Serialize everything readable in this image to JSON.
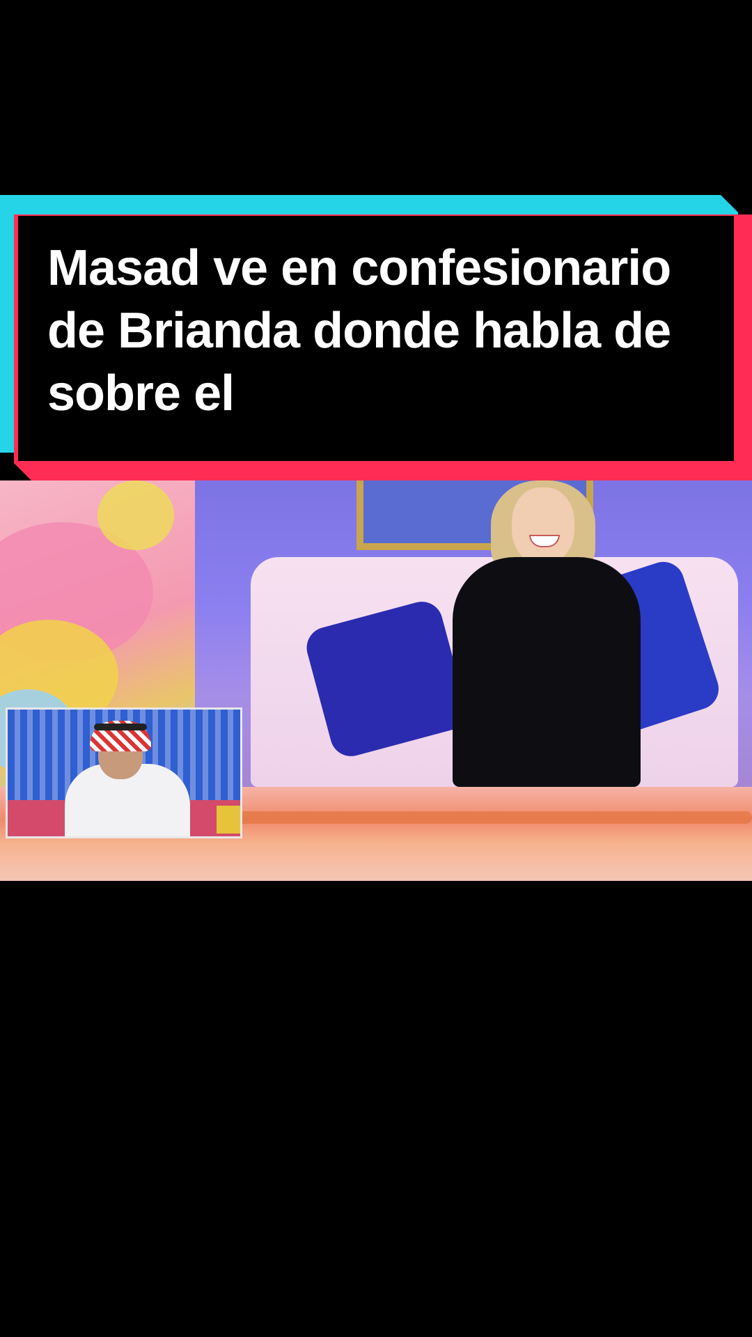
{
  "caption": {
    "text": "Masad ve en confesionario\nde Brianda donde habla de\nsobre el"
  },
  "colors": {
    "caption_border_cyan": "#25d4e6",
    "caption_border_red": "#ff2d55",
    "caption_bg": "#000000",
    "caption_text": "#ffffff"
  },
  "scene": {
    "main_subject": "woman-on-pink-sofa",
    "inset_subject": "man-in-keffiyeh"
  }
}
